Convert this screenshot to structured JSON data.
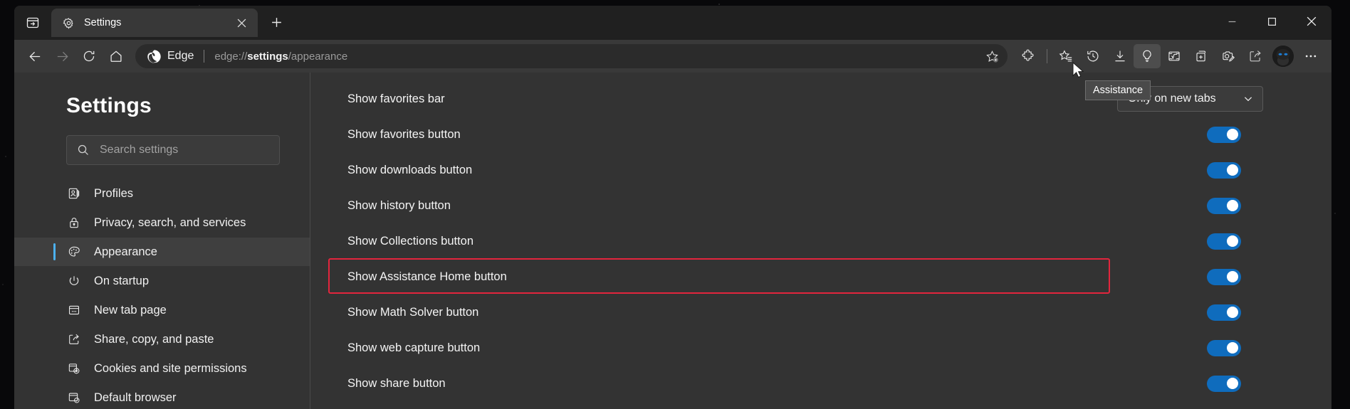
{
  "window": {
    "minimize_label": "Minimize",
    "maximize_label": "Maximize",
    "close_label": "Close"
  },
  "tabstrip": {
    "tab_search_icon": "tab-search-icon",
    "tab": {
      "favicon": "gear-icon",
      "title": "Settings",
      "close_label": "×"
    },
    "new_tab_label": "+"
  },
  "toolbar": {
    "back_label": "Back",
    "forward_label": "Forward",
    "refresh_label": "Refresh",
    "home_label": "Home",
    "omnibox": {
      "brand": "Edge",
      "url_prefix": "edge://",
      "url_bold": "settings",
      "url_suffix": "/appearance",
      "url_full": "edge://settings/appearance",
      "add_favorite_label": "Add this page to favorites"
    },
    "buttons": [
      {
        "name": "extensions-icon",
        "label": "Extensions"
      },
      {
        "name": "favorites-icon",
        "label": "Favorites"
      },
      {
        "name": "history-icon",
        "label": "History"
      },
      {
        "name": "downloads-icon",
        "label": "Downloads"
      },
      {
        "name": "assistance-lightbulb-icon",
        "label": "Assistance"
      },
      {
        "name": "math-solver-icon",
        "label": "Math Solver"
      },
      {
        "name": "collections-icon",
        "label": "Collections"
      },
      {
        "name": "web-capture-icon",
        "label": "Web capture"
      },
      {
        "name": "share-icon",
        "label": "Share"
      }
    ],
    "profile_label": "Profile",
    "more_label": "Settings and more"
  },
  "tooltip": {
    "text": "Assistance"
  },
  "sidebar": {
    "title": "Settings",
    "search": {
      "placeholder": "Search settings",
      "value": ""
    },
    "items": [
      {
        "icon": "profile-icon",
        "label": "Profiles",
        "selected": false
      },
      {
        "icon": "lock-icon",
        "label": "Privacy, search, and services",
        "selected": false
      },
      {
        "icon": "palette-icon",
        "label": "Appearance",
        "selected": true
      },
      {
        "icon": "power-icon",
        "label": "On startup",
        "selected": false
      },
      {
        "icon": "new-tab-page-icon",
        "label": "New tab page",
        "selected": false
      },
      {
        "icon": "share-copy-paste-icon",
        "label": "Share, copy, and paste",
        "selected": false
      },
      {
        "icon": "cookies-icon",
        "label": "Cookies and site permissions",
        "selected": false
      },
      {
        "icon": "default-browser-icon",
        "label": "Default browser",
        "selected": false
      }
    ]
  },
  "main": {
    "rows": [
      {
        "label": "Show favorites bar",
        "control": "dropdown",
        "value": "Only on new tabs",
        "highlighted": false
      },
      {
        "label": "Show favorites button",
        "control": "toggle",
        "value": "on",
        "highlighted": false
      },
      {
        "label": "Show downloads button",
        "control": "toggle",
        "value": "on",
        "highlighted": false
      },
      {
        "label": "Show history button",
        "control": "toggle",
        "value": "on",
        "highlighted": false
      },
      {
        "label": "Show Collections button",
        "control": "toggle",
        "value": "on",
        "highlighted": false
      },
      {
        "label": "Show Assistance Home button",
        "control": "toggle",
        "value": "on",
        "highlighted": true
      },
      {
        "label": "Show Math Solver button",
        "control": "toggle",
        "value": "on",
        "highlighted": false
      },
      {
        "label": "Show web capture button",
        "control": "toggle",
        "value": "on",
        "highlighted": false
      },
      {
        "label": "Show share button",
        "control": "toggle",
        "value": "on",
        "highlighted": false
      }
    ]
  },
  "colors": {
    "accent_blue": "#0f6cbd",
    "selected_accent": "#4cb1ef",
    "annotation_red": "#e3253d",
    "toolbar_bg": "#393939",
    "page_bg": "#333333"
  }
}
